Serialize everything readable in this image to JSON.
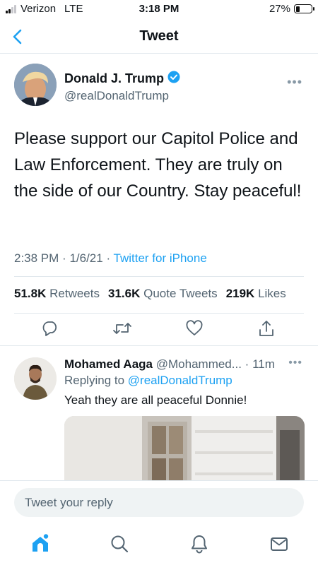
{
  "status_bar": {
    "carrier": "Verizon",
    "network": "LTE",
    "time": "3:18 PM",
    "battery": "27%",
    "battery_level": 0.27
  },
  "nav": {
    "back_icon": "chevron-left-icon",
    "title": "Tweet"
  },
  "tweet": {
    "author_name": "Donald J. Trump",
    "verified": true,
    "author_handle": "@realDonaldTrump",
    "text": "Please support our Capitol Police and Law Enforcement. They are truly on the side of our Country. Stay peaceful!",
    "time": "2:38 PM",
    "date": "1/6/21",
    "source": "Twitter for iPhone",
    "stats": {
      "retweets_count": "51.8K",
      "retweets_label": "Retweets",
      "quotes_count": "31.6K",
      "quotes_label": "Quote Tweets",
      "likes_count": "219K",
      "likes_label": "Likes"
    },
    "actions": [
      "reply-icon",
      "retweet-icon",
      "like-icon",
      "share-icon"
    ]
  },
  "reply": {
    "name": "Mohamed Aaga",
    "handle": "@Mohammed...",
    "age": "11m",
    "replying_label": "Replying to",
    "replying_to": "@realDonaldTrump",
    "text": "Yeah they are all peaceful Donnie!"
  },
  "compose": {
    "placeholder": "Tweet your reply"
  },
  "tab_bar": [
    "home-icon",
    "search-icon",
    "notifications-icon",
    "messages-icon"
  ],
  "colors": {
    "accent": "#1da1f2",
    "secondary_text": "#536471",
    "divider": "#e1e8ed"
  }
}
